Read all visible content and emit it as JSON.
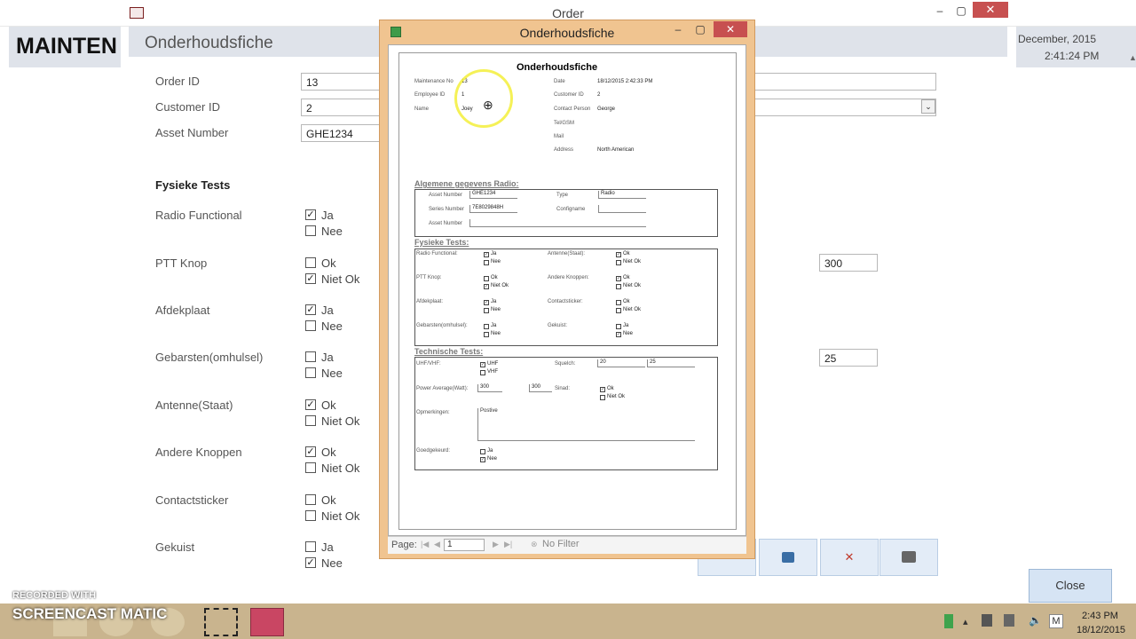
{
  "window": {
    "title": "Order",
    "min": "–",
    "max": "▢",
    "close": "✕"
  },
  "app": {
    "banner": "MAINTEN",
    "form_title": "Onderhoudsfiche",
    "date": "December, 2015",
    "time": "2:41:24 PM"
  },
  "form": {
    "order_id_label": "Order ID",
    "order_id": "13",
    "customer_id_label": "Customer ID",
    "customer_id": "2",
    "asset_number_label": "Asset Number",
    "asset_number": "GHE1234",
    "physical_tests_label": "Fysieke Tests",
    "tests": [
      {
        "label": "Radio Functional",
        "opt1": "Ja",
        "opt2": "Nee",
        "checked": 1
      },
      {
        "label": "PTT Knop",
        "opt1": "Ok",
        "opt2": "Niet Ok",
        "checked": 2
      },
      {
        "label": "Afdekplaat",
        "opt1": "Ja",
        "opt2": "Nee",
        "checked": 1
      },
      {
        "label": "Gebarsten(omhulsel)",
        "opt1": "Ja",
        "opt2": "Nee",
        "checked": 0
      },
      {
        "label": "Antenne(Staat)",
        "opt1": "Ok",
        "opt2": "Niet Ok",
        "checked": 1
      },
      {
        "label": "Andere Knoppen",
        "opt1": "Ok",
        "opt2": "Niet Ok",
        "checked": 1
      },
      {
        "label": "Contactsticker",
        "opt1": "Ok",
        "opt2": "Niet Ok",
        "checked": 0
      },
      {
        "label": "Gekuist",
        "opt1": "Ja",
        "opt2": "Nee",
        "checked": 2
      }
    ],
    "value_300": "300",
    "value_25": "25",
    "close_label": "Close"
  },
  "popup": {
    "title": "Onderhoudsfiche",
    "report_title": "Onderhoudsfiche",
    "maint_no_label": "Maintenance No",
    "maint_no": "13",
    "employee_id_label": "Employee ID",
    "employee_id": "1",
    "name_label": "Name",
    "name": "Joey",
    "date_label": "Date",
    "date": "18/12/2015 2:42:33 PM",
    "customer_id_label": "Customer ID",
    "customer_id": "2",
    "contact_label": "Contact Person",
    "contact": "George",
    "tel_label": "Tel/GSM",
    "mail_label": "Mail",
    "address_label": "Address",
    "address": "North American",
    "general_section": "Algemene gegevens Radio:",
    "asset_label": "Asset Number",
    "asset": "GHE1234",
    "type_label": "Type",
    "type": "Radio",
    "serial_label": "Series Number",
    "serial": "7E8029848H",
    "config_label": "Configname",
    "asset2_label": "Asset Number",
    "physical_section": "Fysieke Tests:",
    "radio_func": "Radio Functional:",
    "rf1": "Ja",
    "rf2": "Nee",
    "antenne": "Antenne(Staat):",
    "an1": "Ok",
    "an2": "Niet Ok",
    "ptt": "PTT Knop:",
    "pt1": "Ok",
    "pt2": "Niet Ok",
    "andere": "Andere Knoppen:",
    "ak1": "Ok",
    "ak2": "Niet Ok",
    "afdek": "Afdekplaat:",
    "af1": "Ja",
    "af2": "Nee",
    "contact_sticker": "Contactsticker:",
    "cs1": "Ok",
    "cs2": "Niet Ok",
    "gebarsten": "Gebarsten(omhulsel):",
    "gb1": "Ja",
    "gb2": "Nee",
    "gekuist": "Gekuist:",
    "gk1": "Ja",
    "gk2": "Nee",
    "technical_section": "Technische Tests:",
    "uhf_label": "UHF/VHF:",
    "uhf": "UHF",
    "vhf": "VHF",
    "squelch_label": "Squelch:",
    "squelch1": "20",
    "squelch2": "25",
    "power_label": "Power Average(Watt):",
    "power1": "300",
    "power2": "300",
    "sinad_label": "Sinad:",
    "sinad1": "Ok",
    "sinad2": "Niet Ok",
    "opm_label": "Opmerkingen:",
    "opm": "Postive",
    "goed_label": "Goedgekeurd:",
    "goed1": "Ja",
    "goed2": "Nee",
    "nav_page_label": "Page:",
    "nav_page": "1",
    "nav_filter": "No Filter",
    "close": "✕",
    "min": "–",
    "max": "▢"
  },
  "taskbar": {
    "recorded": "RECORDED WITH",
    "brand": "SCREENCAST MATIC",
    "time": "2:43 PM",
    "date": "18/12/2015",
    "ime": "M"
  }
}
